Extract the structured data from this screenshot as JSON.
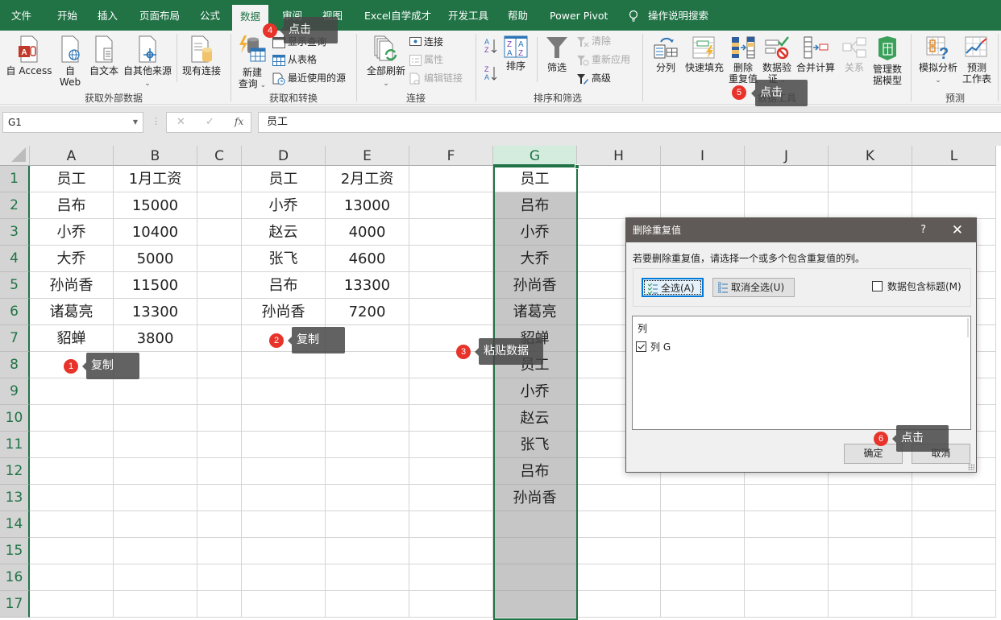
{
  "tabs": {
    "items": [
      {
        "label": "文件",
        "active": false
      },
      {
        "label": "开始",
        "active": false
      },
      {
        "label": "插入",
        "active": false
      },
      {
        "label": "页面布局",
        "active": false
      },
      {
        "label": "公式",
        "active": false
      },
      {
        "label": "数据",
        "active": true
      },
      {
        "label": "审阅",
        "active": false
      },
      {
        "label": "视图",
        "active": false
      },
      {
        "label": "Excel自学成才",
        "active": false
      },
      {
        "label": "开发工具",
        "active": false
      },
      {
        "label": "帮助",
        "active": false
      },
      {
        "label": "Power Pivot",
        "active": false
      }
    ],
    "tell_me": "操作说明搜索"
  },
  "ribbon": {
    "get_external": {
      "label": "获取外部数据",
      "access": "自 Access",
      "web_1": "自",
      "web_2": "Web",
      "text": "自文本",
      "other": "自其他来源",
      "existing": "现有连接"
    },
    "get_transform": {
      "label": "获取和转换",
      "new_query_1": "新建",
      "new_query_2": "查询",
      "show_queries": "显示查询",
      "from_table": "从表格",
      "recent_sources": "最近使用的源"
    },
    "connections": {
      "label": "连接",
      "refresh_all": "全部刷新",
      "connections": "连接",
      "properties": "属性",
      "edit_links": "编辑链接"
    },
    "sort_filter": {
      "label": "排序和筛选",
      "sort": "排序",
      "filter": "筛选",
      "clear": "清除",
      "reapply": "重新应用",
      "advanced": "高级"
    },
    "data_tools": {
      "label": "数据工具",
      "text_to_columns": "分列",
      "flash_fill": "快速填充",
      "remove_dup_1": "删除",
      "remove_dup_2": "重复值",
      "validation_1": "数据验",
      "validation_2": "证",
      "consolidate": "合并计算",
      "relationships": "关系",
      "manage_model_1": "管理数",
      "manage_model_2": "据模型"
    },
    "forecast": {
      "label": "预测",
      "what_if": "模拟分析",
      "forecast_sheet_1": "预测",
      "forecast_sheet_2": "工作表"
    }
  },
  "formula_bar": {
    "name_box": "G1",
    "formula": "员工",
    "fx": "fx"
  },
  "sheet": {
    "columns": [
      "A",
      "B",
      "C",
      "D",
      "E",
      "F",
      "G",
      "H",
      "I",
      "J",
      "K",
      "L"
    ],
    "selected_column": "G",
    "rows": [
      "1",
      "2",
      "3",
      "4",
      "5",
      "6",
      "7",
      "8",
      "9",
      "10",
      "11",
      "12",
      "13",
      "14",
      "15",
      "16",
      "17"
    ],
    "cells": {
      "A": [
        "员工",
        "吕布",
        "小乔",
        "大乔",
        "孙尚香",
        "诸葛亮",
        "貂蝉"
      ],
      "B": [
        "1月工资",
        "15000",
        "10400",
        "5000",
        "11500",
        "13300",
        "3800"
      ],
      "D": [
        "员工",
        "小乔",
        "赵云",
        "张飞",
        "吕布",
        "孙尚香"
      ],
      "E": [
        "2月工资",
        "13000",
        "4000",
        "4600",
        "13300",
        "7200"
      ],
      "G": [
        "员工",
        "吕布",
        "小乔",
        "大乔",
        "孙尚香",
        "诸葛亮",
        "貂蝉",
        "员工",
        "小乔",
        "赵云",
        "张飞",
        "吕布",
        "孙尚香"
      ]
    }
  },
  "callouts": [
    {
      "num": "1",
      "text": "复制"
    },
    {
      "num": "2",
      "text": "复制"
    },
    {
      "num": "3",
      "text": "粘贴数据"
    },
    {
      "num": "4",
      "text": "点击"
    },
    {
      "num": "5",
      "text": "点击"
    },
    {
      "num": "6",
      "text": "点击"
    }
  ],
  "dialog": {
    "title": "删除重复值",
    "help": "?",
    "close": "✕",
    "description": "若要删除重复值，请选择一个或多个包含重复值的列。",
    "select_all": "全选(A)",
    "unselect_all": "取消全选(U)",
    "has_headers": "数据包含标题(M)",
    "has_headers_checked": false,
    "list_header": "列",
    "columns": [
      {
        "label": "列 G",
        "checked": true
      }
    ],
    "ok": "确定",
    "cancel": "取消"
  }
}
